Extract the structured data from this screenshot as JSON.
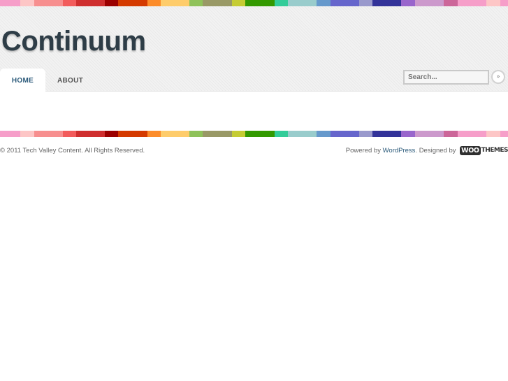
{
  "header": {
    "site_title": "Continuum"
  },
  "nav": {
    "items": [
      {
        "label": "HOME",
        "active": true
      },
      {
        "label": "ABOUT",
        "active": false
      }
    ]
  },
  "search": {
    "placeholder": "Search...",
    "submit_label": "»"
  },
  "footer": {
    "copyright": "© 2011 Tech Valley Content. All Rights Reserved.",
    "powered_by_prefix": "Powered by ",
    "powered_by_link": "WordPress",
    "designed_by_prefix": ". Designed by ",
    "woo_logo_part1": "WOO",
    "woo_logo_part2": "THEMES"
  },
  "colors": {
    "title": "#2e3d47",
    "nav_active": "#2b5a7a",
    "link": "#2b5a7a",
    "stripe": [
      "#f69ec9",
      "#fdc6c6",
      "#f78f8f",
      "#f25c5c",
      "#cf2f2f",
      "#9b0000",
      "#d43a00",
      "#fc8c2a",
      "#fecc6b",
      "#8fc25a",
      "#999966",
      "#c5cc33",
      "#339900",
      "#33cc99",
      "#99cccc",
      "#6699cc",
      "#6666cc",
      "#9999cc",
      "#333399",
      "#9966cc",
      "#cc99cc",
      "#cc6699",
      "#f69ec9",
      "#fdc6c6",
      "#f69ec9"
    ]
  }
}
